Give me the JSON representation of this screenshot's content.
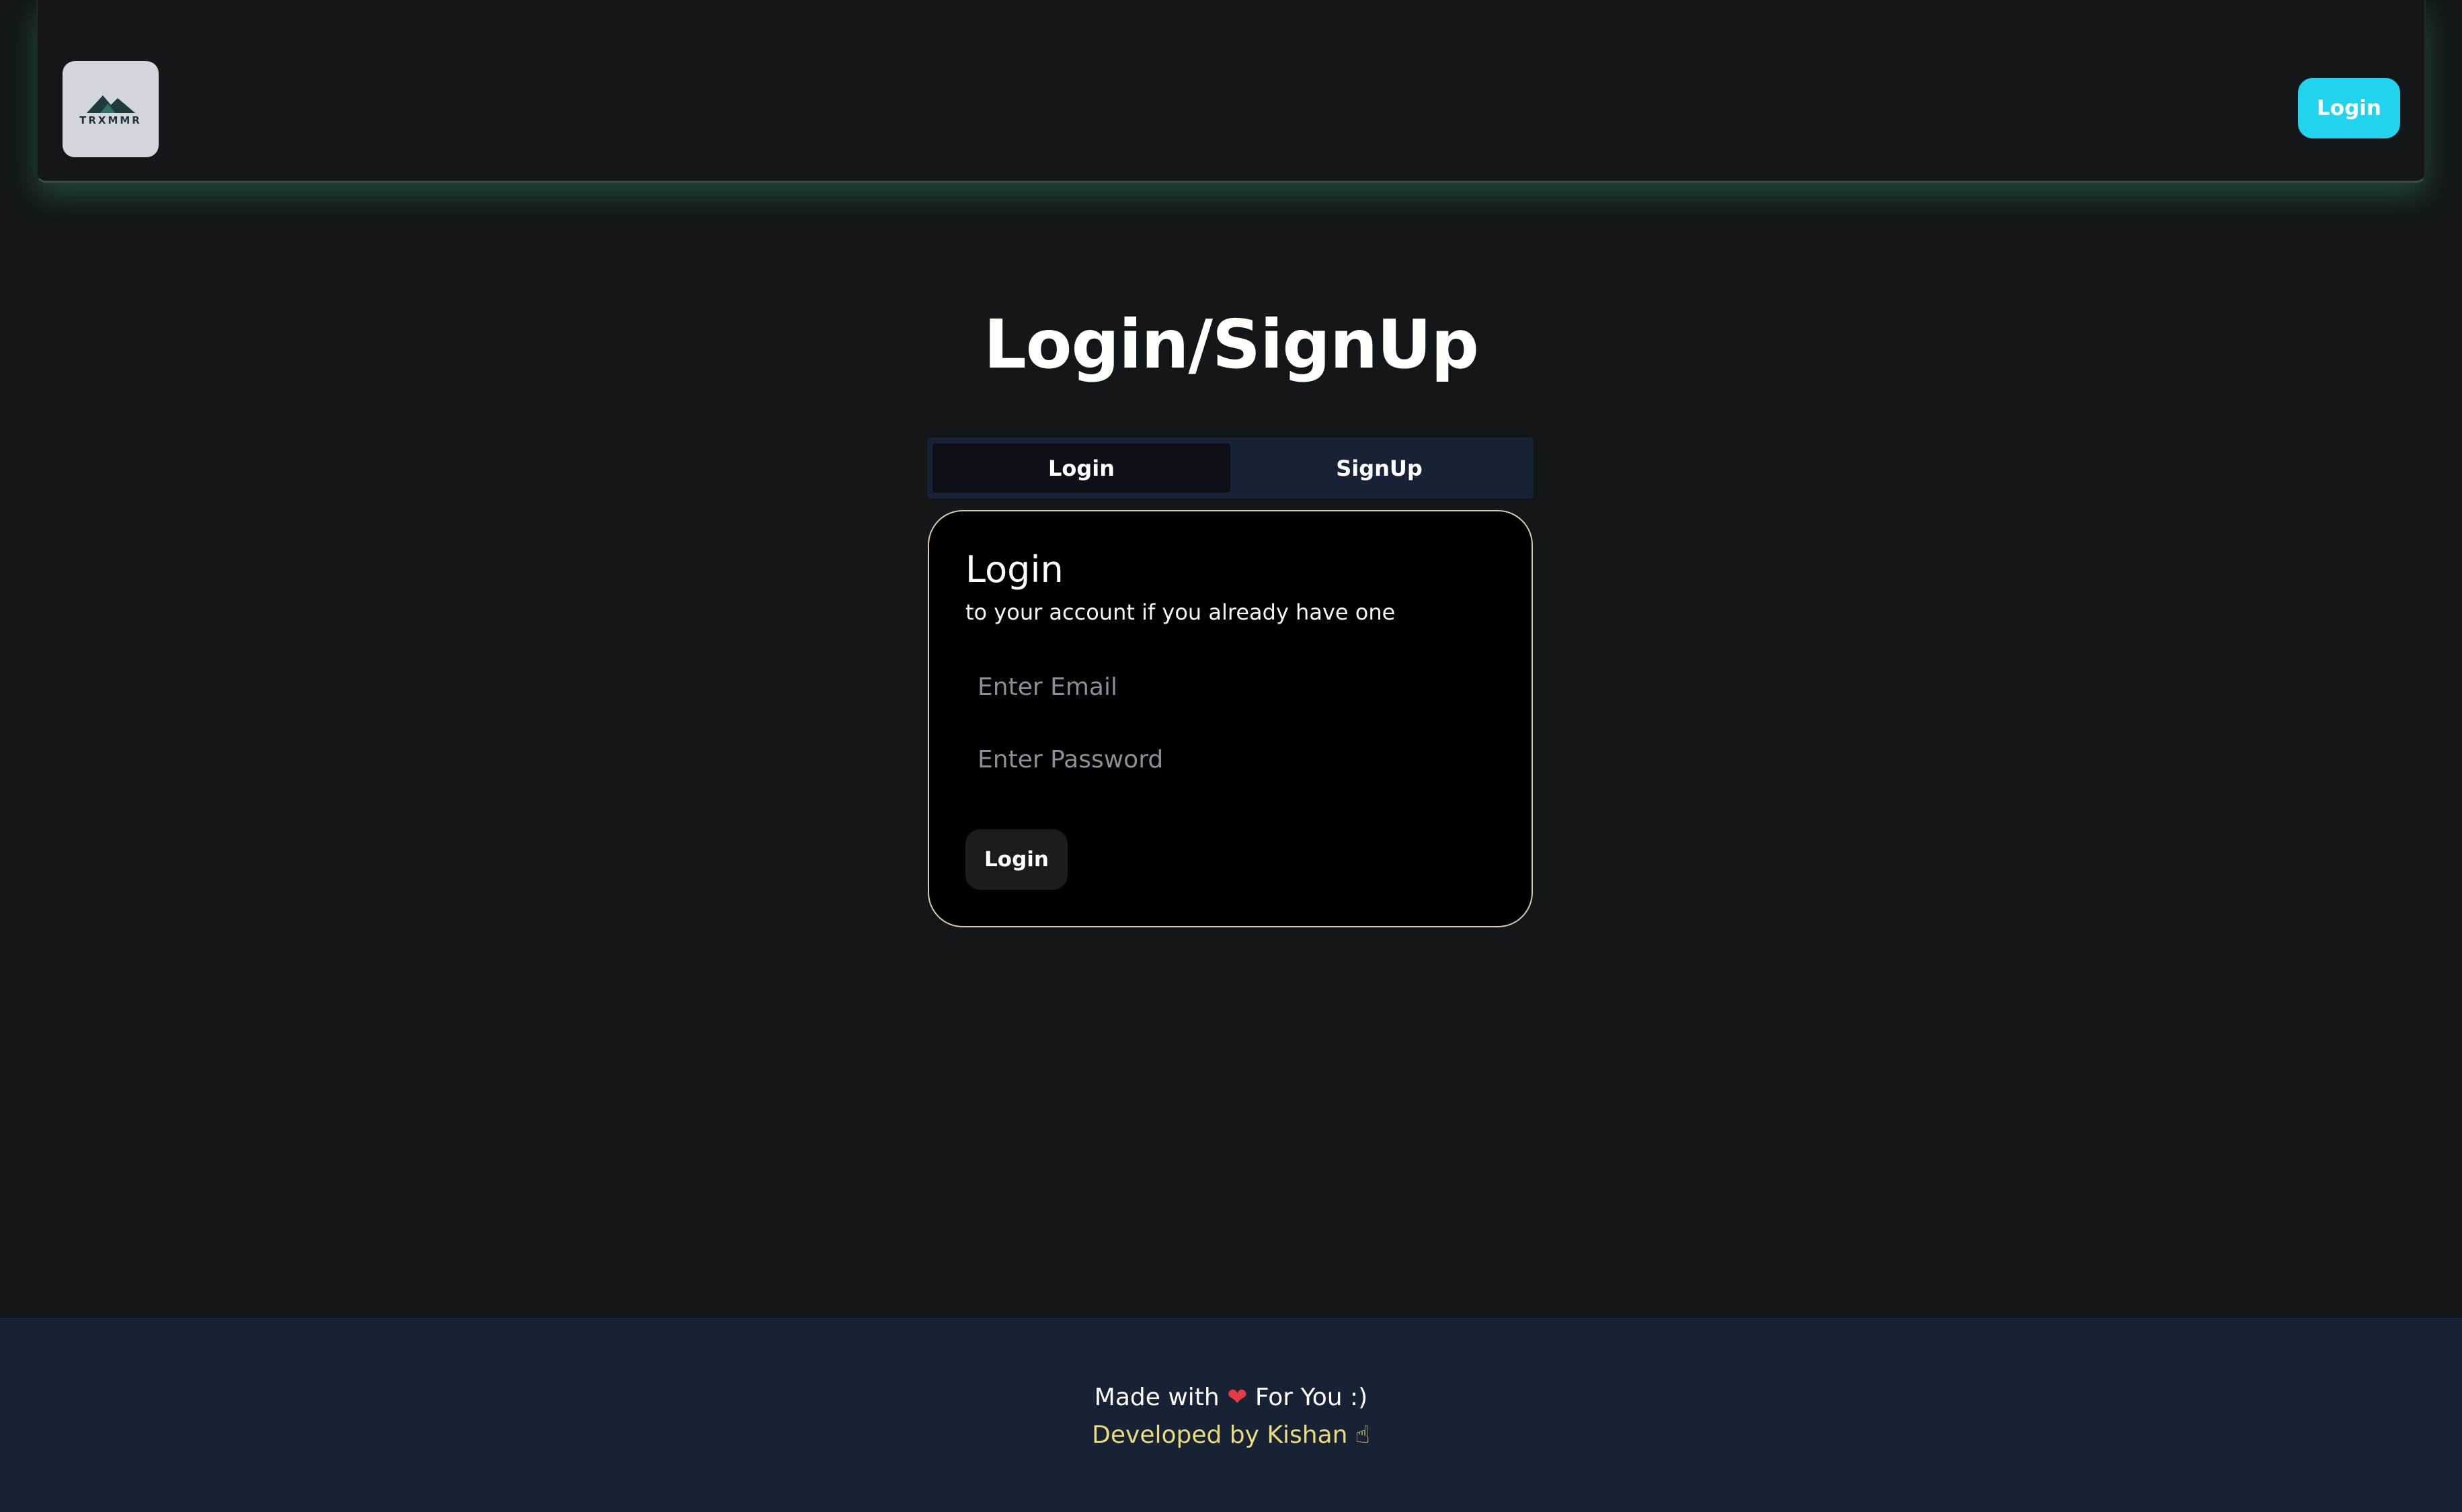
{
  "header": {
    "logo_text": "TRXMMR",
    "login_label": "Login"
  },
  "main": {
    "title": "Login/SignUp",
    "tabs": [
      {
        "label": "Login",
        "active": true
      },
      {
        "label": "SignUp",
        "active": false
      }
    ],
    "card": {
      "title": "Login",
      "subtitle": "to your account if you already have one",
      "email_placeholder": "Enter Email",
      "password_placeholder": "Enter Password",
      "submit_label": "Login"
    }
  },
  "footer": {
    "made_with_prefix": "Made with",
    "heart_icon": "❤",
    "made_with_suffix": "For You :)",
    "developed_by": "Developed by Kishan",
    "hand_icon": "☝"
  },
  "colors": {
    "background": "#131719",
    "accent": "#22d3ee",
    "card_border": "#d8cba5",
    "footer_bg": "#172235",
    "developer_text": "#eadb7a"
  }
}
